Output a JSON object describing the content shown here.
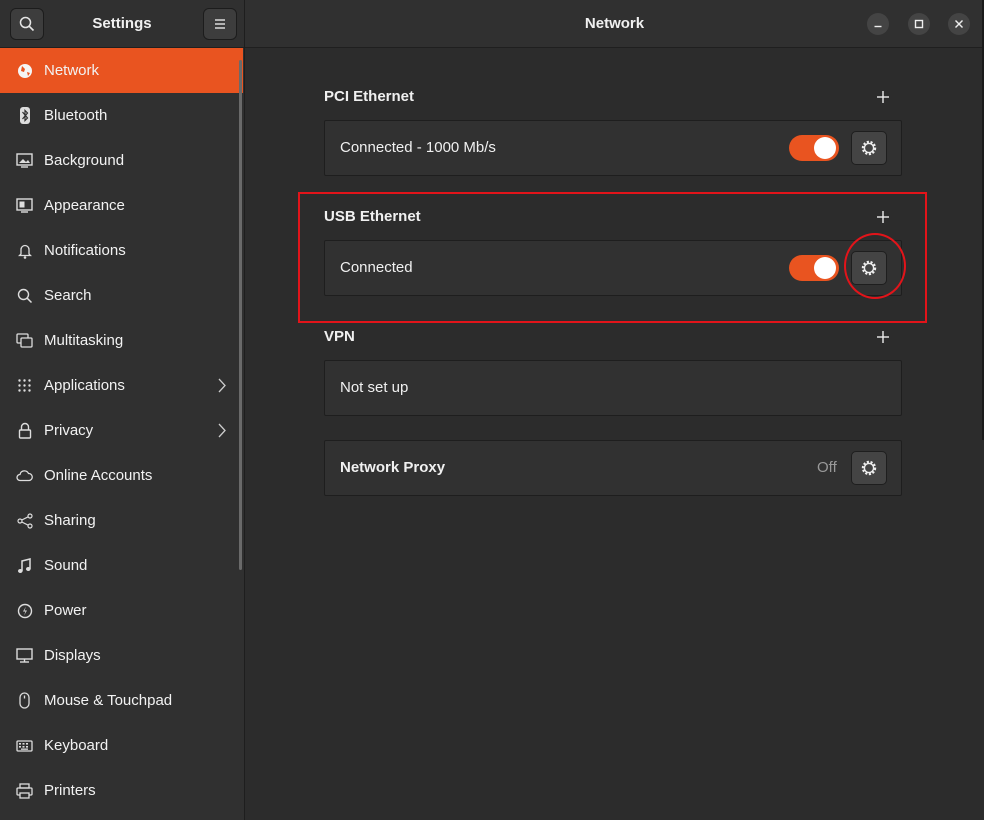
{
  "sidebar": {
    "title": "Settings",
    "items": [
      {
        "label": "Network",
        "icon": "network-icon"
      },
      {
        "label": "Bluetooth",
        "icon": "bluetooth-icon"
      },
      {
        "label": "Background",
        "icon": "background-icon"
      },
      {
        "label": "Appearance",
        "icon": "appearance-icon"
      },
      {
        "label": "Notifications",
        "icon": "bell-icon"
      },
      {
        "label": "Search",
        "icon": "search-icon"
      },
      {
        "label": "Multitasking",
        "icon": "multitasking-icon"
      },
      {
        "label": "Applications",
        "icon": "grid-icon"
      },
      {
        "label": "Privacy",
        "icon": "lock-icon"
      },
      {
        "label": "Online Accounts",
        "icon": "cloud-icon"
      },
      {
        "label": "Sharing",
        "icon": "share-icon"
      },
      {
        "label": "Sound",
        "icon": "music-note-icon"
      },
      {
        "label": "Power",
        "icon": "power-icon"
      },
      {
        "label": "Displays",
        "icon": "display-icon"
      },
      {
        "label": "Mouse & Touchpad",
        "icon": "mouse-icon"
      },
      {
        "label": "Keyboard",
        "icon": "keyboard-icon"
      },
      {
        "label": "Printers",
        "icon": "printer-icon"
      }
    ]
  },
  "header": {
    "title": "Network"
  },
  "sections": {
    "pci": {
      "title": "PCI Ethernet",
      "status": "Connected - 1000 Mb/s"
    },
    "usb": {
      "title": "USB Ethernet",
      "status": "Connected"
    },
    "vpn": {
      "title": "VPN",
      "status": "Not set up"
    },
    "proxy": {
      "label": "Network Proxy",
      "state": "Off"
    }
  },
  "colors": {
    "accent": "#e95420",
    "annotation": "#e2141a"
  }
}
